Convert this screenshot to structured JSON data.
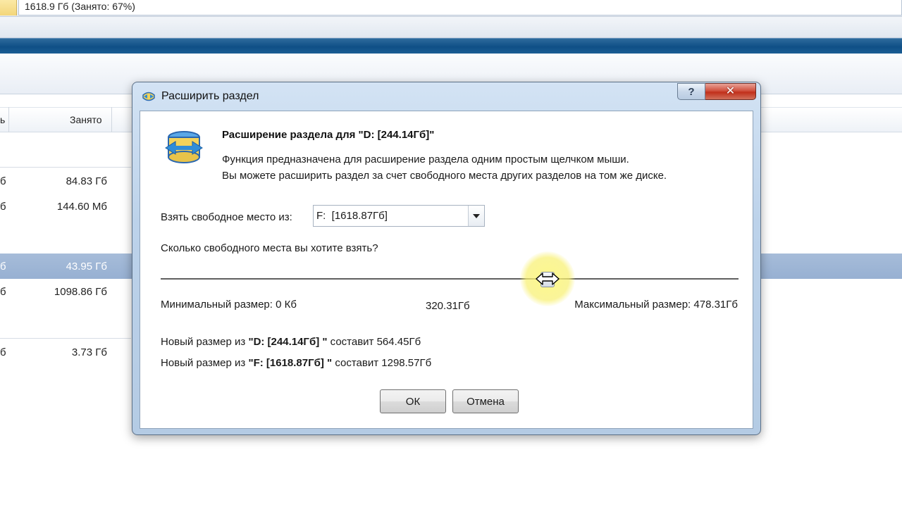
{
  "background": {
    "usage_text": "1618.9 Гб (Занято: 67%)",
    "column_header_left": "ь",
    "column_header_used": "Занято",
    "rows": [
      {
        "left": "б",
        "value": "84.83 Гб",
        "selected": false
      },
      {
        "left": "б",
        "value": "144.60 Мб",
        "selected": false
      },
      {
        "left": "б",
        "value": "43.95 Гб",
        "selected": true
      },
      {
        "left": "б",
        "value": "1098.86 Гб",
        "selected": false
      },
      {
        "left": "б",
        "value": "3.73 Гб",
        "selected": false
      }
    ]
  },
  "dialog": {
    "title": "Расширить раздел",
    "help_label": "?",
    "close_label": "✕",
    "heading": "Расширение раздела для \"D: [244.14Гб]\"",
    "description_line1": "Функция предназначена для расширение раздела одним простым щелчком мыши.",
    "description_line2": "Вы можете расширить раздел за счет свободного места других разделов на том же диске.",
    "take_from_label": "Взять свободное место из:",
    "take_from_value": "F:  [1618.87Гб]",
    "how_much_label": "Сколько свободного места вы хотите взять?",
    "slider": {
      "min_label": "Минимальный размер: 0 Кб",
      "max_label": "Максимальный размер: 478.31Гб",
      "current_label": "320.31Гб",
      "fraction": 0.67
    },
    "new_size_d": {
      "prefix": "Новый размер из ",
      "partition": "\"D: [244.14Гб] \"",
      "suffix": " составит 564.45Гб"
    },
    "new_size_f": {
      "prefix": "Новый размер из ",
      "partition": "\"F: [1618.87Гб] \"",
      "suffix": " составит 1298.57Гб"
    },
    "ok_label": "ОК",
    "cancel_label": "Отмена"
  },
  "colors": {
    "dialog_frame": "#bcd2ea",
    "close_button": "#c1301b",
    "selected_row": "#97b0d2",
    "blue_band": "#0f4f86"
  },
  "icons": {
    "title_icon": "extend-partition-icon",
    "heading_icon": "extend-partition-icon",
    "cursor": "horizontal-resize-cursor-icon"
  }
}
